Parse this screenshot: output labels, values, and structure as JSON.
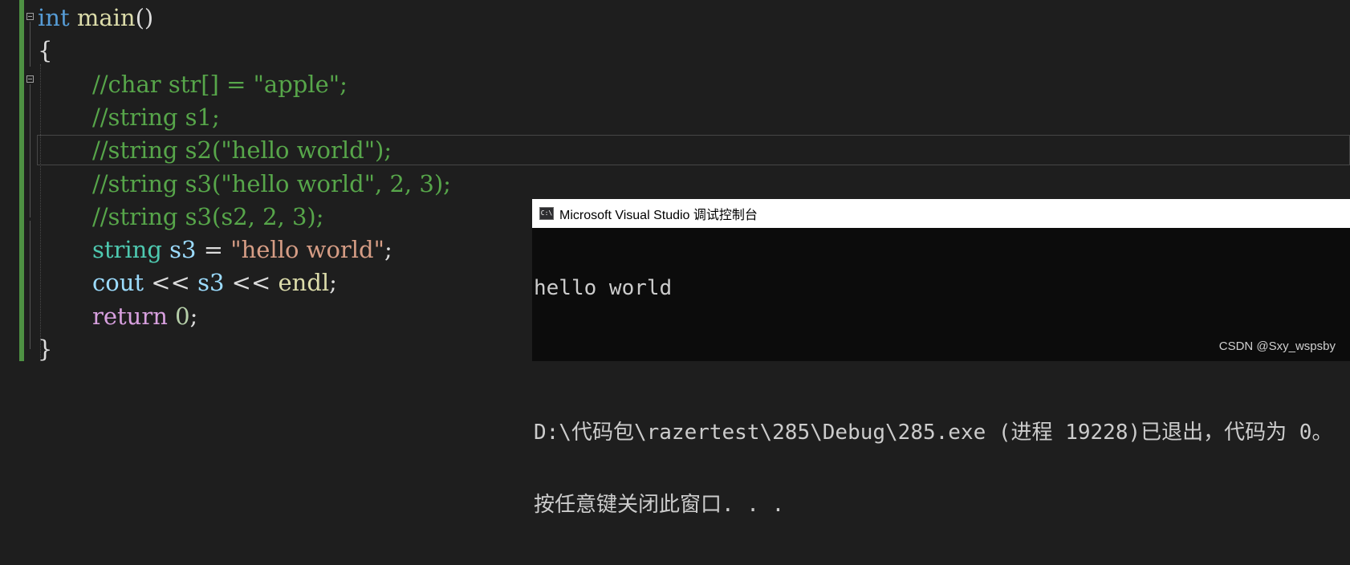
{
  "editor": {
    "lines": [
      {
        "id": "l1",
        "parts": [
          {
            "t": "int",
            "c": "kw"
          },
          {
            "t": " ",
            "c": ""
          },
          {
            "t": "main",
            "c": "fn"
          },
          {
            "t": "()",
            "c": ""
          }
        ]
      },
      {
        "id": "l2",
        "parts": [
          {
            "t": "{",
            "c": ""
          }
        ]
      },
      {
        "id": "l3",
        "indent": true,
        "parts": [
          {
            "t": "//char str[] = \"apple\";",
            "c": "cmt"
          }
        ]
      },
      {
        "id": "l4",
        "indent": true,
        "parts": [
          {
            "t": "//string s1;",
            "c": "cmt"
          }
        ]
      },
      {
        "id": "l5",
        "indent": true,
        "parts": [
          {
            "t": "//string s2(\"hello world\");",
            "c": "cmt"
          }
        ]
      },
      {
        "id": "l6",
        "indent": true,
        "parts": [
          {
            "t": "//string s3(\"hello world\", 2, 3);",
            "c": "cmt"
          }
        ]
      },
      {
        "id": "l7",
        "indent": true,
        "parts": [
          {
            "t": "//string s3(s2, 2, 3);",
            "c": "cmt"
          }
        ]
      },
      {
        "id": "l8",
        "indent": true,
        "parts": [
          {
            "t": "string",
            "c": "type"
          },
          {
            "t": " ",
            "c": ""
          },
          {
            "t": "s3",
            "c": "var"
          },
          {
            "t": " = ",
            "c": ""
          },
          {
            "t": "\"hello world\"",
            "c": "str"
          },
          {
            "t": ";",
            "c": ""
          }
        ]
      },
      {
        "id": "l9",
        "indent": true,
        "parts": [
          {
            "t": "cout",
            "c": "var"
          },
          {
            "t": " << ",
            "c": ""
          },
          {
            "t": "s3",
            "c": "var"
          },
          {
            "t": " << ",
            "c": ""
          },
          {
            "t": "endl",
            "c": "fn"
          },
          {
            "t": ";",
            "c": ""
          }
        ]
      },
      {
        "id": "l10",
        "indent": true,
        "parts": [
          {
            "t": "return",
            "c": "kw2"
          },
          {
            "t": " ",
            "c": ""
          },
          {
            "t": "0",
            "c": "num"
          },
          {
            "t": ";",
            "c": ""
          }
        ]
      },
      {
        "id": "l11",
        "parts": [
          {
            "t": "}",
            "c": ""
          }
        ]
      }
    ]
  },
  "console": {
    "icon_label": "C:\\",
    "title": "Microsoft Visual Studio 调试控制台",
    "output": [
      "hello world",
      "",
      "D:\\代码包\\razertest\\285\\Debug\\285.exe (进程 19228)已退出，代码为 0。",
      "按任意键关闭此窗口. . ."
    ]
  },
  "watermark": "CSDN @Sxy_wspsby",
  "colors": {
    "editor_bg": "#1e1e1e",
    "keyword": "#569cd6",
    "comment": "#57a64a",
    "string": "#d69d85",
    "variable": "#9cdcfe",
    "function": "#dcdcaa",
    "number": "#b5cea8",
    "type": "#4ec9b0",
    "control": "#d8a0df",
    "console_bg": "#0c0c0c"
  }
}
